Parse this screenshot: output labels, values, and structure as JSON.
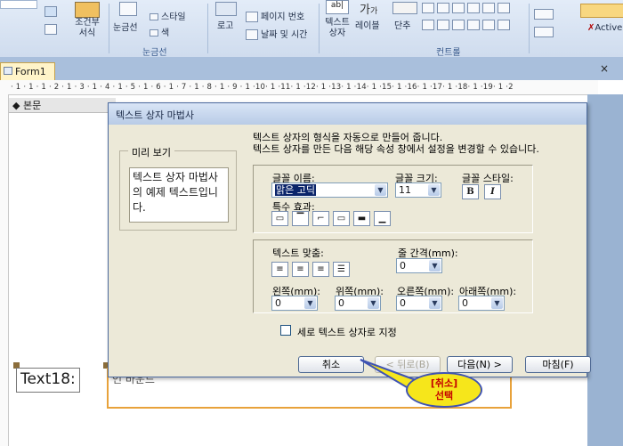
{
  "ribbon": {
    "group_label_gridlines": "눈금선",
    "group_label_controls": "컨트롤",
    "conditional_format": "조건부\n서식",
    "gridlines_btn": "눈금선",
    "style_btn": "스타일",
    "color_btn": "색",
    "logo_btn": "로고",
    "page_number_btn": "페이지 번호",
    "date_time_btn": "날짜 및 시간",
    "textbox_btn": "텍스트\n상자",
    "label_btn": "레이블",
    "button_btn": "단추",
    "activex_btn": "Active"
  },
  "tabs": {
    "form_tab": "Form1",
    "close_glyph": "×"
  },
  "ruler": {
    "marks": "· 1 · 1 · 1 · 2 · 1 · 3 · 1 · 4 · 1 · 5 · 1 · 6 · 1 · 7 · 1 · 8 · 1 · 9 · 1 ·10· 1 ·11· 1 ·12· 1 ·13· 1 ·14· 1 ·15· 1 ·16· 1 ·17· 1 ·18· 1 ·19· 1 ·2"
  },
  "design": {
    "section_label": "◆ 본문",
    "textbox_label": "Text18:",
    "textbox_field": "언 바운드"
  },
  "dialog": {
    "title": "텍스트 상자 마법사",
    "desc_line1": "텍스트 상자의 형식을 자동으로 만들어 줍니다.",
    "desc_line2": "텍스트 상자를 만든 다음 해당 속성 창에서 설정을 변경할 수 있습니다.",
    "preview_group": "미리 보기",
    "preview_text": "텍스트 상자 마법사의 예제 텍스트입니다.",
    "font_name_label": "글꼴 이름:",
    "font_name_value": "맑은 고딕",
    "font_size_label": "글꼴 크기:",
    "font_size_value": "11",
    "font_style_label": "글꼴 스타일:",
    "bold_glyph": "B",
    "italic_glyph": "I",
    "special_effect_label": "특수 효과:",
    "align_label": "텍스트 맞춤:",
    "line_spacing_label": "줄 간격(mm):",
    "line_spacing_value": "0",
    "left_margin_label": "왼쪽(mm):",
    "left_margin_value": "0",
    "top_margin_label": "위쪽(mm):",
    "top_margin_value": "0",
    "right_margin_label": "오른쪽(mm):",
    "right_margin_value": "0",
    "bottom_margin_label": "아래쪽(mm):",
    "bottom_margin_value": "0",
    "vertical_checkbox_label": "세로 텍스트 상자로 지정",
    "cancel_btn": "취소",
    "back_btn": "< 뒤로(B)",
    "next_btn": "다음(N) >",
    "finish_btn": "마침(F)"
  },
  "callout": {
    "line1": "[취소]",
    "line2": "선택"
  },
  "colors": {
    "callout_fill": "#f6e61b",
    "callout_text": "#c40000",
    "dialog_bg": "#ece9d8",
    "selection_border": "#e8a23a"
  }
}
